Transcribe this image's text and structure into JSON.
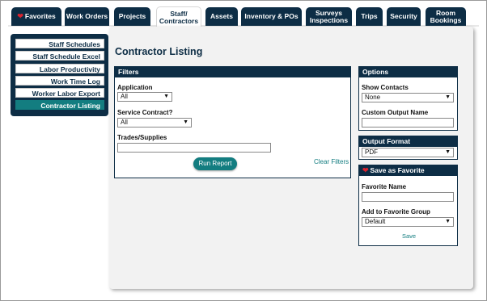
{
  "colors": {
    "navy": "#0d2d45",
    "teal": "#137d80",
    "heart": "#d9232f"
  },
  "tabs": [
    {
      "icon": "heart-icon",
      "label": "Favorites"
    },
    {
      "label": "Work Orders"
    },
    {
      "label": "Projects"
    },
    {
      "line1": "Staff/",
      "line2": "Contractors",
      "active": true
    },
    {
      "label": "Assets"
    },
    {
      "label": "Inventory & POs"
    },
    {
      "line1": "Surveys",
      "line2": "Inspections"
    },
    {
      "label": "Trips"
    },
    {
      "label": "Security"
    },
    {
      "line1": "Room",
      "line2": "Bookings"
    }
  ],
  "sidebar": {
    "items": [
      {
        "label": "Staff Schedules"
      },
      {
        "label": "Staff Schedule Excel"
      },
      {
        "label": "Labor Productivity"
      },
      {
        "label": "Work Time Log"
      },
      {
        "label": "Worker Labor Export"
      },
      {
        "label": "Contractor Listing",
        "active": true
      }
    ]
  },
  "page": {
    "title": "Contractor Listing"
  },
  "filters": {
    "header": "Filters",
    "application_label": "Application",
    "application_value": "All",
    "service_contract_label": "Service Contract?",
    "service_contract_value": "All",
    "trades_label": "Trades/Supplies",
    "trades_value": "",
    "run_button": "Run Report",
    "clear_link": "Clear Filters"
  },
  "options": {
    "header": "Options",
    "show_contacts_label": "Show Contacts",
    "show_contacts_value": "None",
    "custom_output_label": "Custom Output Name",
    "custom_output_value": ""
  },
  "output_format": {
    "header": "Output Format",
    "value": "PDF"
  },
  "favorite": {
    "header": "Save as Favorite",
    "name_label": "Favorite Name",
    "name_value": "",
    "group_label": "Add to Favorite Group",
    "group_value": "Default",
    "save_link": "Save"
  }
}
